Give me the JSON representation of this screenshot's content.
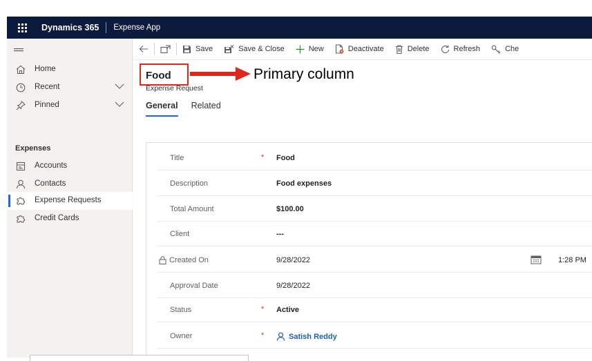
{
  "topbar": {
    "brand": "Dynamics 365",
    "app_name": "Expense App"
  },
  "sidebar": {
    "items": [
      {
        "label": "Home",
        "icon": "home-icon"
      },
      {
        "label": "Recent",
        "icon": "clock-icon"
      },
      {
        "label": "Pinned",
        "icon": "pin-icon"
      }
    ],
    "group_label": "Expenses",
    "group_items": [
      {
        "label": "Accounts",
        "icon": "accounts-icon"
      },
      {
        "label": "Contacts",
        "icon": "person-icon"
      },
      {
        "label": "Expense Requests",
        "icon": "puzzle-icon",
        "selected": true
      },
      {
        "label": "Credit Cards",
        "icon": "puzzle-icon"
      }
    ]
  },
  "commands": {
    "save": "Save",
    "save_close": "Save & Close",
    "new": "New",
    "deactivate": "Deactivate",
    "delete": "Delete",
    "refresh": "Refresh",
    "check": "Che"
  },
  "record": {
    "title": "Food",
    "entity": "Expense Request",
    "annotation": "Primary column"
  },
  "tabs": [
    "General",
    "Related"
  ],
  "fields": {
    "title": {
      "label": "Title",
      "value": "Food"
    },
    "description": {
      "label": "Description",
      "value": "Food expenses"
    },
    "total": {
      "label": "Total Amount",
      "value": "$100.00"
    },
    "client": {
      "label": "Client",
      "value": "---"
    },
    "created": {
      "label": "Created On",
      "date": "9/28/2022",
      "time": "1:28 PM"
    },
    "approval": {
      "label": "Approval Date",
      "value": "9/28/2022"
    },
    "status": {
      "label": "Status",
      "value": "Active"
    },
    "owner": {
      "label": "Owner",
      "value": "Satish Reddy"
    }
  },
  "colors": {
    "topbar": "#0b1a3d",
    "accent": "#2266e3",
    "link": "#1e5fb3",
    "annotation_red": "#e0271b"
  }
}
